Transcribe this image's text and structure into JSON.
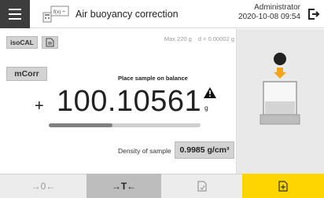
{
  "header": {
    "title": "Air buoyancy correction",
    "user": "Administrator",
    "datetime": "2020-10-08  09:54",
    "app_icon_text": "f(x) ÷"
  },
  "toolbar": {
    "isocal_label": "isoCAL",
    "max_capacity": "Max 220 g",
    "readability": "d = 0.00002 g",
    "mcorr_label": "mCorr"
  },
  "main": {
    "instruction": "Place sample on balance",
    "sign": "+",
    "weight_value": "100.10561",
    "unit": "g",
    "progress_fraction": 0.42,
    "density_label": "Density of sample",
    "density_value": "0.9985 g/cm³"
  },
  "bottom_bar": {
    "zero_label": "→0←",
    "tare_label": "→T←"
  },
  "colors": {
    "header_menu_bg": "#3d3d3d",
    "accent_yellow": "#ffd500",
    "arrow_orange": "#f2a51a",
    "tare_active_bg": "#bdbdbd"
  },
  "icons": [
    "menu-icon",
    "app-function-icon",
    "logout-icon",
    "document-icon",
    "warning-icon",
    "beaker-icon",
    "weight-ball-icon",
    "down-arrow-icon",
    "add-document-icon"
  ]
}
